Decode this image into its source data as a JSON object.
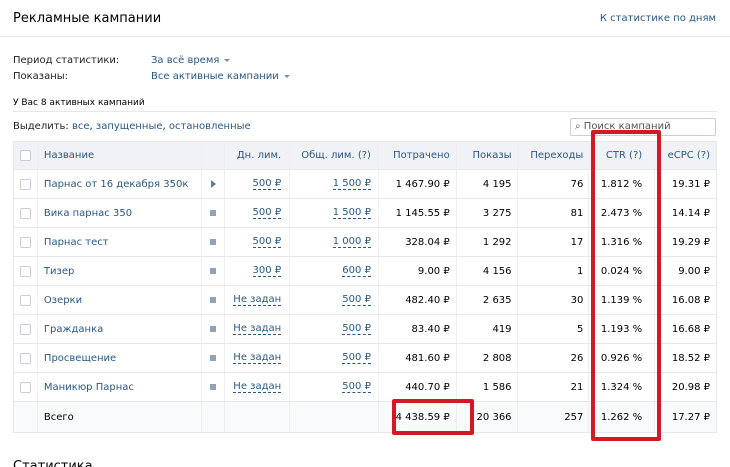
{
  "header": {
    "title": "Рекламные кампании",
    "stats_link": "К статистике по дням"
  },
  "filters": {
    "period_label": "Период статистики:",
    "period_value": "За всё время",
    "shown_label": "Показаны:",
    "shown_value": "Все активные кампании"
  },
  "count_text": "У Вас 8 активных кампаний",
  "select": {
    "prefix": "Выделить:",
    "all": "все",
    "running": "запущенные",
    "stopped": "остановленные"
  },
  "search": {
    "placeholder": "Поиск кампаний"
  },
  "table": {
    "columns": {
      "name": "Название",
      "day_limit": "Дн. лим.",
      "total_limit": "Общ. лим. (?)",
      "spent": "Потрачено",
      "impressions": "Показы",
      "clicks": "Переходы",
      "ctr": "CTR (?)",
      "ecpc": "eCPC (?)"
    },
    "rows": [
      {
        "name": "Парнас от 16 декабря 350к",
        "status": "running",
        "day_limit": "500 ₽",
        "total_limit": "1 500 ₽",
        "spent": "1 467.90 ₽",
        "impressions": "4 195",
        "clicks": "76",
        "ctr": "1.812 %",
        "ecpc": "19.31 ₽"
      },
      {
        "name": "Вика парнас 350",
        "status": "stopped",
        "day_limit": "500 ₽",
        "total_limit": "1 500 ₽",
        "spent": "1 145.55 ₽",
        "impressions": "3 275",
        "clicks": "81",
        "ctr": "2.473 %",
        "ecpc": "14.14 ₽"
      },
      {
        "name": "Парнас тест",
        "status": "stopped",
        "day_limit": "500 ₽",
        "total_limit": "1 000 ₽",
        "spent": "328.04 ₽",
        "impressions": "1 292",
        "clicks": "17",
        "ctr": "1.316 %",
        "ecpc": "19.29 ₽"
      },
      {
        "name": "Тизер",
        "status": "stopped",
        "day_limit": "300 ₽",
        "total_limit": "600 ₽",
        "spent": "9.00 ₽",
        "impressions": "4 156",
        "clicks": "1",
        "ctr": "0.024 %",
        "ecpc": "9.00 ₽"
      },
      {
        "name": "Озерки",
        "status": "stopped",
        "day_limit": "Не задан",
        "total_limit": "500 ₽",
        "spent": "482.40 ₽",
        "impressions": "2 635",
        "clicks": "30",
        "ctr": "1.139 %",
        "ecpc": "16.08 ₽"
      },
      {
        "name": "Гражданка",
        "status": "stopped",
        "day_limit": "Не задан",
        "total_limit": "500 ₽",
        "spent": "83.40 ₽",
        "impressions": "419",
        "clicks": "5",
        "ctr": "1.193 %",
        "ecpc": "16.68 ₽"
      },
      {
        "name": "Просвещение",
        "status": "stopped",
        "day_limit": "Не задан",
        "total_limit": "500 ₽",
        "spent": "481.60 ₽",
        "impressions": "2 808",
        "clicks": "26",
        "ctr": "0.926 %",
        "ecpc": "18.52 ₽"
      },
      {
        "name": "Маникюр Парнас",
        "status": "stopped",
        "day_limit": "Не задан",
        "total_limit": "500 ₽",
        "spent": "440.70 ₽",
        "impressions": "1 586",
        "clicks": "21",
        "ctr": "1.324 %",
        "ecpc": "20.98 ₽"
      }
    ],
    "total": {
      "label": "Всего",
      "spent": "4 438.59 ₽",
      "impressions": "20 366",
      "clicks": "257",
      "ctr": "1.262 %",
      "ecpc": "17.27 ₽"
    }
  },
  "stats_heading": "Статистика",
  "colors": {
    "link": "#2a5885",
    "highlight": "#d11a23",
    "header_bg": "#f0f2f5"
  }
}
